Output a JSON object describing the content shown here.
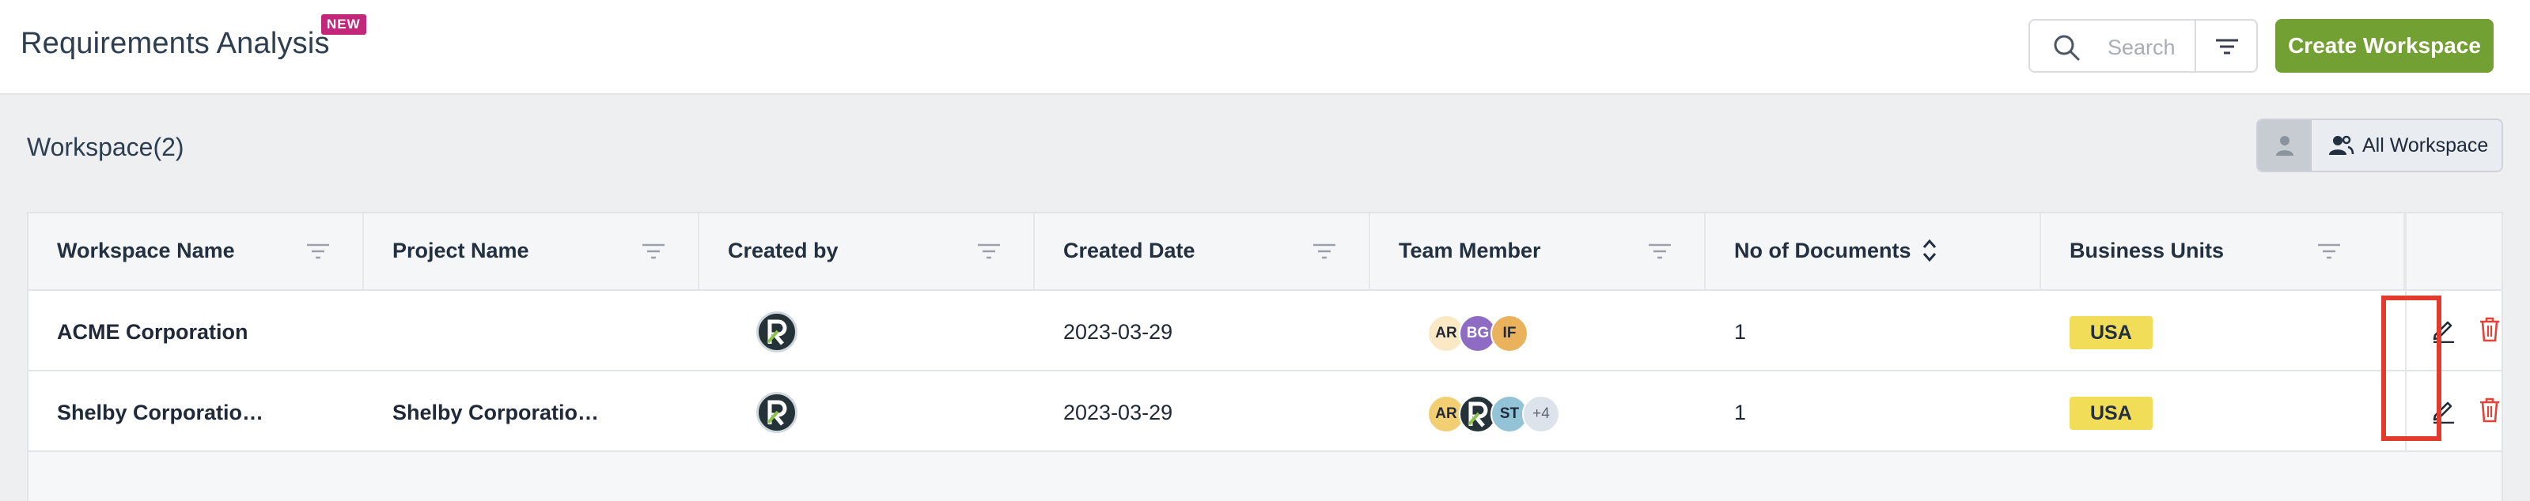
{
  "header": {
    "title": "Requirements Analysis",
    "badge": "NEW",
    "search_placeholder": "Search",
    "create_button": "Create Workspace"
  },
  "workspace": {
    "title": "Workspace(2)",
    "view_toggle_label": "All Workspace"
  },
  "table": {
    "columns": [
      {
        "label": "Workspace Name",
        "icon": "filter-icon"
      },
      {
        "label": "Project Name",
        "icon": "filter-icon"
      },
      {
        "label": "Created by",
        "icon": "filter-icon"
      },
      {
        "label": "Created Date",
        "icon": "filter-icon"
      },
      {
        "label": "Team Member",
        "icon": "filter-icon"
      },
      {
        "label": "No of Documents",
        "icon": "sort-icon"
      },
      {
        "label": "Business Units",
        "icon": "filter-icon"
      }
    ],
    "rows": [
      {
        "workspace_name": "ACME Corporation",
        "project_name": "",
        "created_date": "2023-03-29",
        "members": [
          "AR",
          "BG",
          "IF"
        ],
        "documents": "1",
        "business_unit": "USA"
      },
      {
        "workspace_name": "Shelby Corporatio…",
        "project_name": "Shelby Corporatio…",
        "created_date": "2023-03-29",
        "members": [
          "AR",
          "ST"
        ],
        "members_more": "+4",
        "documents": "1",
        "business_unit": "USA"
      }
    ]
  },
  "colors": {
    "primary_green": "#73a033",
    "badge_pink": "#c2277a",
    "unit_yellow": "#f2dd58",
    "delete_red": "#e0453a",
    "highlight_red": "#e23a2c"
  }
}
